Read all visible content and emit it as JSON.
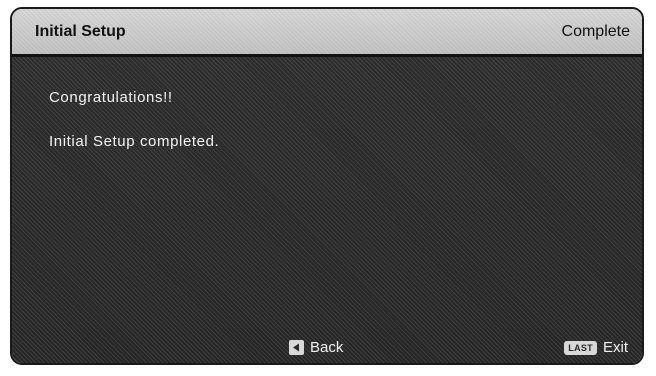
{
  "dialog": {
    "title": "Initial Setup",
    "step": "Complete"
  },
  "messages": {
    "line1": "Congratulations!!",
    "line2": "Initial Setup completed."
  },
  "footer": {
    "back_label": "Back",
    "back_icon": "back-key-icon",
    "exit_key": "LAST",
    "exit_label": "Exit"
  }
}
